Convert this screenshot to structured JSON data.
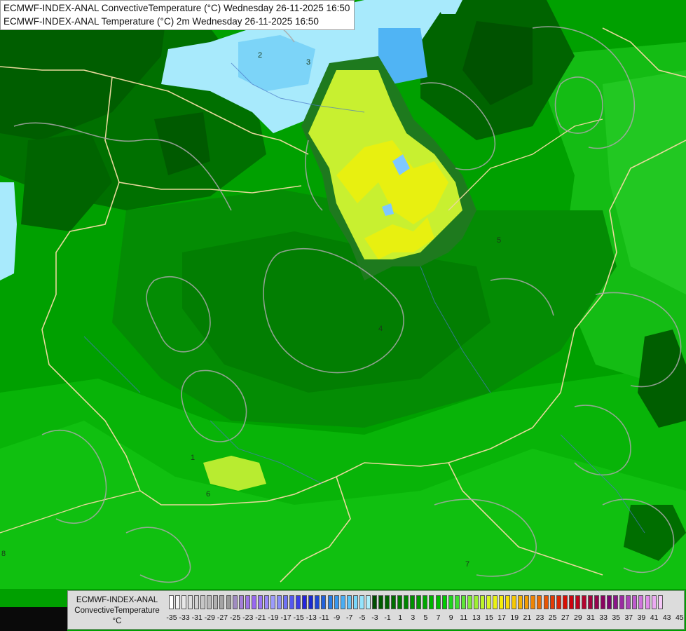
{
  "header": {
    "line1": "ECMWF-INDEX-ANAL ConvectiveTemperature (°C) Wednesday 26-11-2025 16:50",
    "line2": "ECMWF-INDEX-ANAL Temperature (°C) 2m Wednesday 26-11-2025 16:50"
  },
  "legend": {
    "line1": "ECMWF-INDEX-ANAL",
    "line2": "ConvectiveTemperature",
    "line3": "°C",
    "ticks": [
      "-35",
      "-33",
      "-31",
      "-29",
      "-27",
      "-25",
      "-23",
      "-21",
      "-19",
      "-17",
      "-15",
      "-13",
      "-11",
      "-9",
      "-7",
      "-5",
      "-3",
      "-1",
      "1",
      "3",
      "5",
      "7",
      "9",
      "11",
      "13",
      "15",
      "17",
      "19",
      "21",
      "23",
      "25",
      "27",
      "29",
      "31",
      "33",
      "35",
      "37",
      "39",
      "41",
      "43",
      "45"
    ],
    "colors": [
      "#ffffff",
      "#f4f4f4",
      "#e8e8e8",
      "#dedede",
      "#d2d2d2",
      "#c6c6c6",
      "#bababa",
      "#b0b0b0",
      "#a4a4a4",
      "#9a9a9a",
      "#a08cc0",
      "#a47ed6",
      "#9e72e6",
      "#9868f0",
      "#9a76f6",
      "#9a88fa",
      "#9c9cfc",
      "#8a8cf8",
      "#6e72f4",
      "#5558ee",
      "#3c3ce6",
      "#2424dc",
      "#1a2ad0",
      "#1e46d4",
      "#2262dc",
      "#2a7ee6",
      "#3896ee",
      "#4aaef4",
      "#5ec2f8",
      "#78d6fa",
      "#94e4fc",
      "#b0eefc",
      "#004d00",
      "#005a00",
      "#006400",
      "#006e00",
      "#007a00",
      "#008400",
      "#009000",
      "#009a00",
      "#00a600",
      "#00b200",
      "#00be00",
      "#00ca00",
      "#1ed41e",
      "#3ede2e",
      "#5ee636",
      "#7eec36",
      "#9ef032",
      "#bcf428",
      "#d8f620",
      "#eaf214",
      "#f4ec0a",
      "#f6dc06",
      "#f6c804",
      "#f4b204",
      "#f29c04",
      "#ee8404",
      "#ea6c04",
      "#e65404",
      "#e23c04",
      "#dc2404",
      "#d61004",
      "#cc0410",
      "#c0041e",
      "#b2042e",
      "#a4043e",
      "#96044e",
      "#8a0460",
      "#7e0472",
      "#8a1688",
      "#9a2ca0",
      "#ac44b8",
      "#be5ccc",
      "#d074dc",
      "#e08cea",
      "#ecaaf2",
      "#f6c8f8"
    ]
  },
  "contour_labels": [
    "1",
    "2",
    "3",
    "4",
    "5",
    "6",
    "7",
    "8"
  ]
}
